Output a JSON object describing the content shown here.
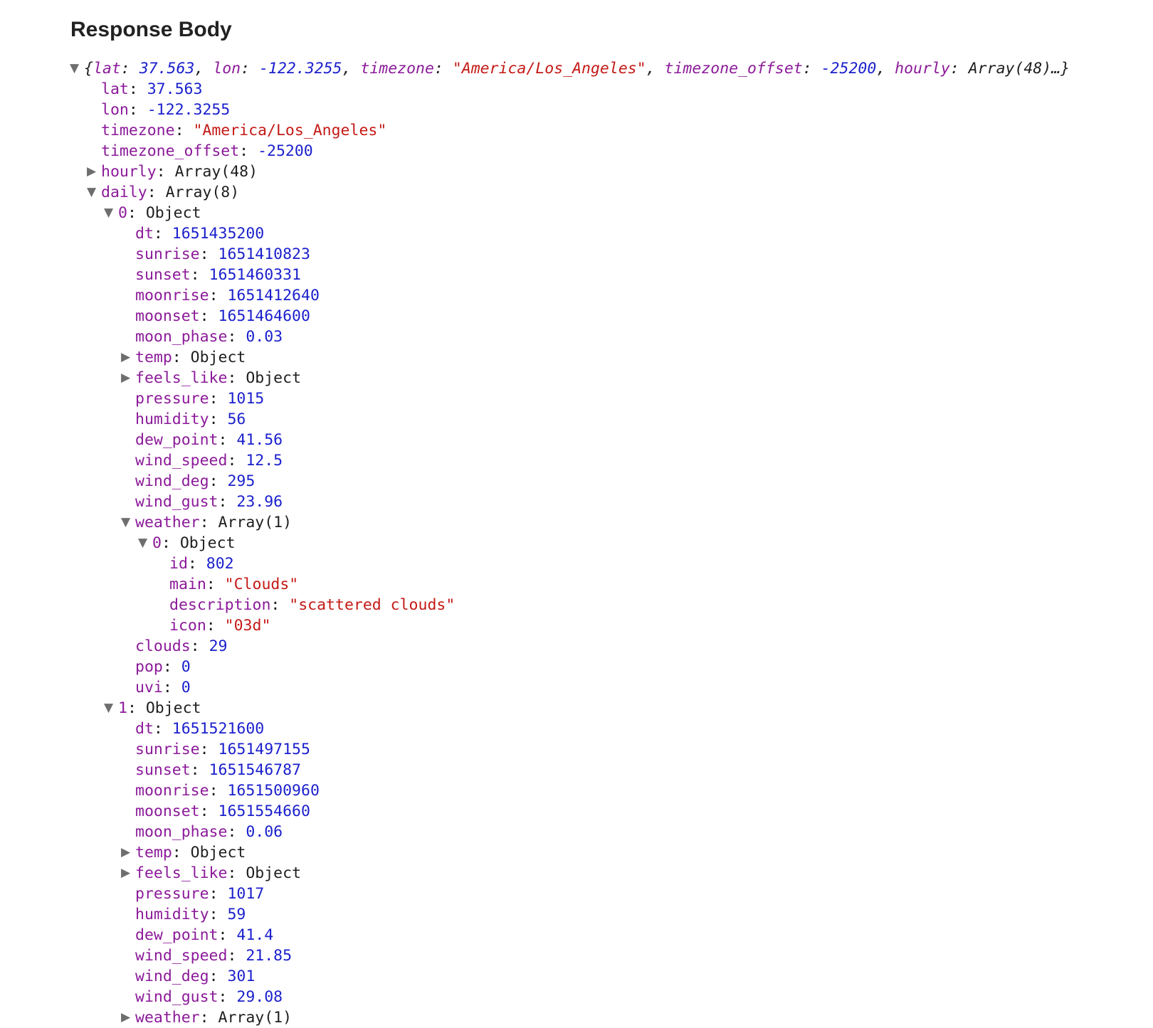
{
  "heading": "Response Body",
  "icons": {
    "expanded": "triangle-down-icon",
    "collapsed": "triangle-right-icon"
  },
  "colors": {
    "key": "#8b1a99",
    "number": "#1a1fcc",
    "string": "#c41a16",
    "object": "#1e1e1e",
    "toggle": "#6e6e6e"
  },
  "tree": [
    {
      "level": 0,
      "toggle": "expanded",
      "summary": true,
      "parts": [
        {
          "t": "{",
          "c": "punc"
        },
        {
          "t": "lat",
          "c": "key"
        },
        {
          "t": ": ",
          "c": "punc"
        },
        {
          "t": "37.563",
          "c": "num"
        },
        {
          "t": ", ",
          "c": "punc"
        },
        {
          "t": "lon",
          "c": "key"
        },
        {
          "t": ": ",
          "c": "punc"
        },
        {
          "t": "-122.3255",
          "c": "num"
        },
        {
          "t": ", ",
          "c": "punc"
        },
        {
          "t": "timezone",
          "c": "key"
        },
        {
          "t": ": ",
          "c": "punc"
        },
        {
          "t": "\"America/Los_Angeles\"",
          "c": "str"
        },
        {
          "t": ", ",
          "c": "punc"
        },
        {
          "t": "timezone_offset",
          "c": "key"
        },
        {
          "t": ": ",
          "c": "punc"
        },
        {
          "t": "-25200",
          "c": "num"
        },
        {
          "t": ", ",
          "c": "punc"
        },
        {
          "t": "hourly",
          "c": "key"
        },
        {
          "t": ": ",
          "c": "punc"
        },
        {
          "t": "Array(48)…}",
          "c": "obj"
        }
      ]
    },
    {
      "level": 1,
      "key": "lat",
      "value": "37.563",
      "type": "num"
    },
    {
      "level": 1,
      "key": "lon",
      "value": "-122.3255",
      "type": "num"
    },
    {
      "level": 1,
      "key": "timezone",
      "value": "\"America/Los_Angeles\"",
      "type": "str"
    },
    {
      "level": 1,
      "key": "timezone_offset",
      "value": "-25200",
      "type": "num"
    },
    {
      "level": 1,
      "toggle": "collapsed",
      "key": "hourly",
      "value": "Array(48)",
      "type": "obj"
    },
    {
      "level": 1,
      "toggle": "expanded",
      "key": "daily",
      "value": "Array(8)",
      "type": "obj"
    },
    {
      "level": 2,
      "toggle": "expanded",
      "key": "0",
      "value": "Object",
      "type": "obj"
    },
    {
      "level": 3,
      "key": "dt",
      "value": "1651435200",
      "type": "num"
    },
    {
      "level": 3,
      "key": "sunrise",
      "value": "1651410823",
      "type": "num"
    },
    {
      "level": 3,
      "key": "sunset",
      "value": "1651460331",
      "type": "num"
    },
    {
      "level": 3,
      "key": "moonrise",
      "value": "1651412640",
      "type": "num"
    },
    {
      "level": 3,
      "key": "moonset",
      "value": "1651464600",
      "type": "num"
    },
    {
      "level": 3,
      "key": "moon_phase",
      "value": "0.03",
      "type": "num"
    },
    {
      "level": 3,
      "toggle": "collapsed",
      "key": "temp",
      "value": "Object",
      "type": "obj"
    },
    {
      "level": 3,
      "toggle": "collapsed",
      "key": "feels_like",
      "value": "Object",
      "type": "obj"
    },
    {
      "level": 3,
      "key": "pressure",
      "value": "1015",
      "type": "num"
    },
    {
      "level": 3,
      "key": "humidity",
      "value": "56",
      "type": "num"
    },
    {
      "level": 3,
      "key": "dew_point",
      "value": "41.56",
      "type": "num"
    },
    {
      "level": 3,
      "key": "wind_speed",
      "value": "12.5",
      "type": "num"
    },
    {
      "level": 3,
      "key": "wind_deg",
      "value": "295",
      "type": "num"
    },
    {
      "level": 3,
      "key": "wind_gust",
      "value": "23.96",
      "type": "num"
    },
    {
      "level": 3,
      "toggle": "expanded",
      "key": "weather",
      "value": "Array(1)",
      "type": "obj"
    },
    {
      "level": 4,
      "toggle": "expanded",
      "key": "0",
      "value": "Object",
      "type": "obj"
    },
    {
      "level": 5,
      "key": "id",
      "value": "802",
      "type": "num"
    },
    {
      "level": 5,
      "key": "main",
      "value": "\"Clouds\"",
      "type": "str"
    },
    {
      "level": 5,
      "key": "description",
      "value": "\"scattered clouds\"",
      "type": "str"
    },
    {
      "level": 5,
      "key": "icon",
      "value": "\"03d\"",
      "type": "str"
    },
    {
      "level": 3,
      "key": "clouds",
      "value": "29",
      "type": "num"
    },
    {
      "level": 3,
      "key": "pop",
      "value": "0",
      "type": "num"
    },
    {
      "level": 3,
      "key": "uvi",
      "value": "0",
      "type": "num"
    },
    {
      "level": 2,
      "toggle": "expanded",
      "key": "1",
      "value": "Object",
      "type": "obj"
    },
    {
      "level": 3,
      "key": "dt",
      "value": "1651521600",
      "type": "num"
    },
    {
      "level": 3,
      "key": "sunrise",
      "value": "1651497155",
      "type": "num"
    },
    {
      "level": 3,
      "key": "sunset",
      "value": "1651546787",
      "type": "num"
    },
    {
      "level": 3,
      "key": "moonrise",
      "value": "1651500960",
      "type": "num"
    },
    {
      "level": 3,
      "key": "moonset",
      "value": "1651554660",
      "type": "num"
    },
    {
      "level": 3,
      "key": "moon_phase",
      "value": "0.06",
      "type": "num"
    },
    {
      "level": 3,
      "toggle": "collapsed",
      "key": "temp",
      "value": "Object",
      "type": "obj"
    },
    {
      "level": 3,
      "toggle": "collapsed",
      "key": "feels_like",
      "value": "Object",
      "type": "obj"
    },
    {
      "level": 3,
      "key": "pressure",
      "value": "1017",
      "type": "num"
    },
    {
      "level": 3,
      "key": "humidity",
      "value": "59",
      "type": "num"
    },
    {
      "level": 3,
      "key": "dew_point",
      "value": "41.4",
      "type": "num"
    },
    {
      "level": 3,
      "key": "wind_speed",
      "value": "21.85",
      "type": "num"
    },
    {
      "level": 3,
      "key": "wind_deg",
      "value": "301",
      "type": "num"
    },
    {
      "level": 3,
      "key": "wind_gust",
      "value": "29.08",
      "type": "num"
    },
    {
      "level": 3,
      "toggle": "collapsed",
      "key": "weather",
      "value": "Array(1)",
      "type": "obj"
    }
  ]
}
